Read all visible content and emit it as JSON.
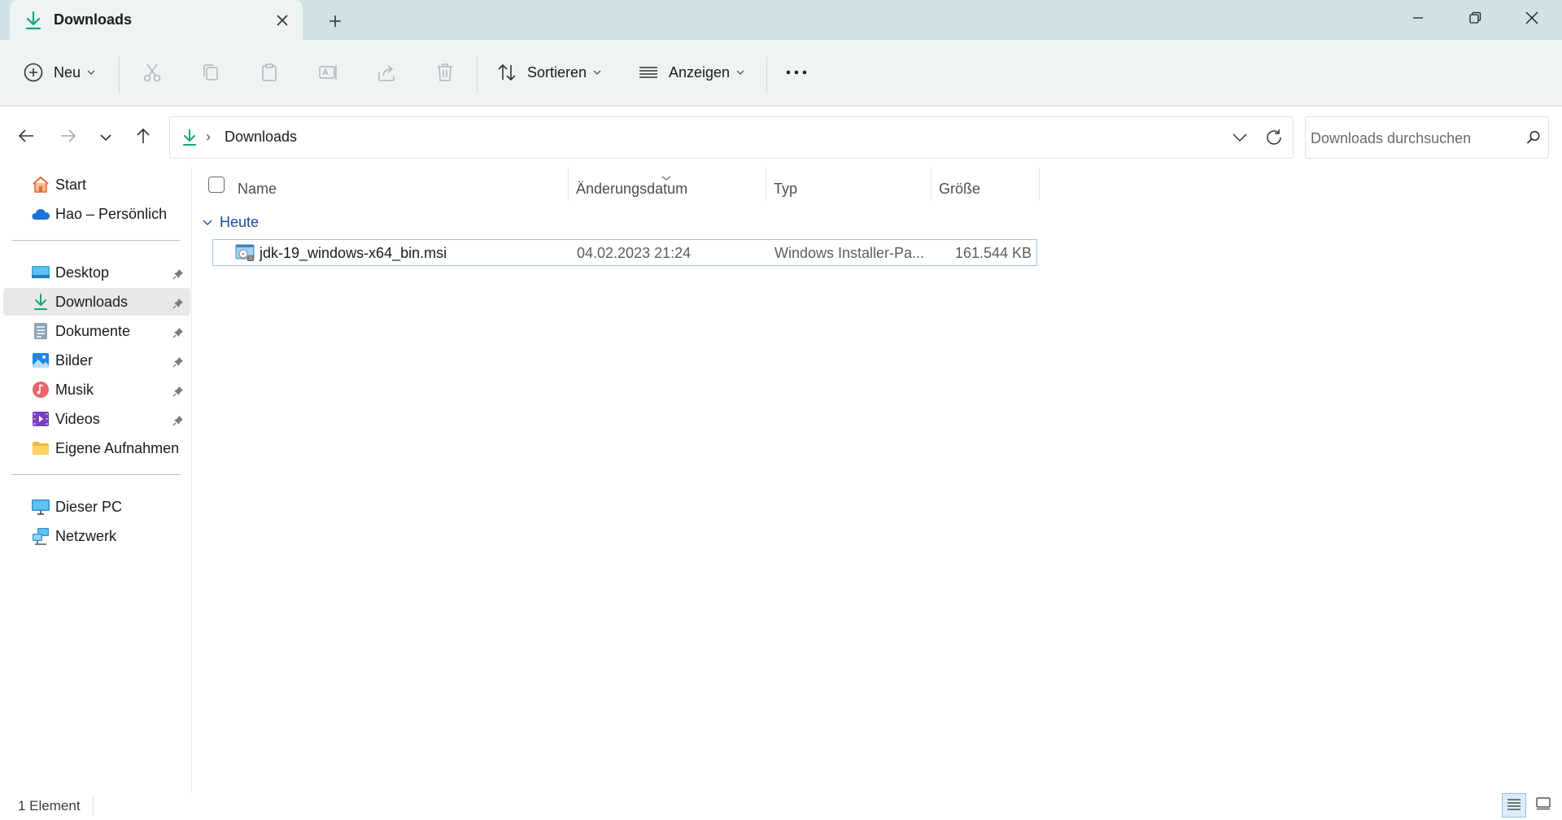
{
  "window": {
    "tab_title": "Downloads",
    "new_tab_label": "+"
  },
  "toolbar": {
    "new_label": "Neu",
    "sort_label": "Sortieren",
    "view_label": "Anzeigen",
    "more_label": "•••"
  },
  "address": {
    "path": "Downloads",
    "separator": "›",
    "search_placeholder": "Downloads durchsuchen"
  },
  "sidebar": {
    "quick": [
      {
        "label": "Start",
        "icon": "home-icon"
      },
      {
        "label": "Hao – Persönlich",
        "icon": "onedrive-cloud-icon"
      }
    ],
    "pinned": [
      {
        "label": "Desktop",
        "icon": "desktop-icon",
        "pinned": true
      },
      {
        "label": "Downloads",
        "icon": "download-icon",
        "pinned": true,
        "selected": true
      },
      {
        "label": "Dokumente",
        "icon": "documents-icon",
        "pinned": true
      },
      {
        "label": "Bilder",
        "icon": "pictures-icon",
        "pinned": true
      },
      {
        "label": "Musik",
        "icon": "music-icon",
        "pinned": true
      },
      {
        "label": "Videos",
        "icon": "videos-icon",
        "pinned": true
      },
      {
        "label": "Eigene Aufnahmen",
        "icon": "folder-icon",
        "pinned": false
      }
    ],
    "system": [
      {
        "label": "Dieser PC",
        "icon": "pc-icon"
      },
      {
        "label": "Netzwerk",
        "icon": "network-icon"
      }
    ]
  },
  "filelist": {
    "columns": {
      "name": "Name",
      "date": "Änderungsdatum",
      "type": "Typ",
      "size": "Größe"
    },
    "group": "Heute",
    "files": [
      {
        "name": "jdk-19_windows-x64_bin.msi",
        "date": "04.02.2023 21:24",
        "type": "Windows Installer-Pa...",
        "size": "161.544 KB",
        "icon": "msi-installer-icon"
      }
    ]
  },
  "status": {
    "count": "1 Element"
  },
  "colors": {
    "titlebar": "#cfe2e5",
    "commandbar": "#eef3f4",
    "download_accent": "#18a47c",
    "group_link": "#1c4a9e",
    "selection_border": "#99c9ef"
  }
}
